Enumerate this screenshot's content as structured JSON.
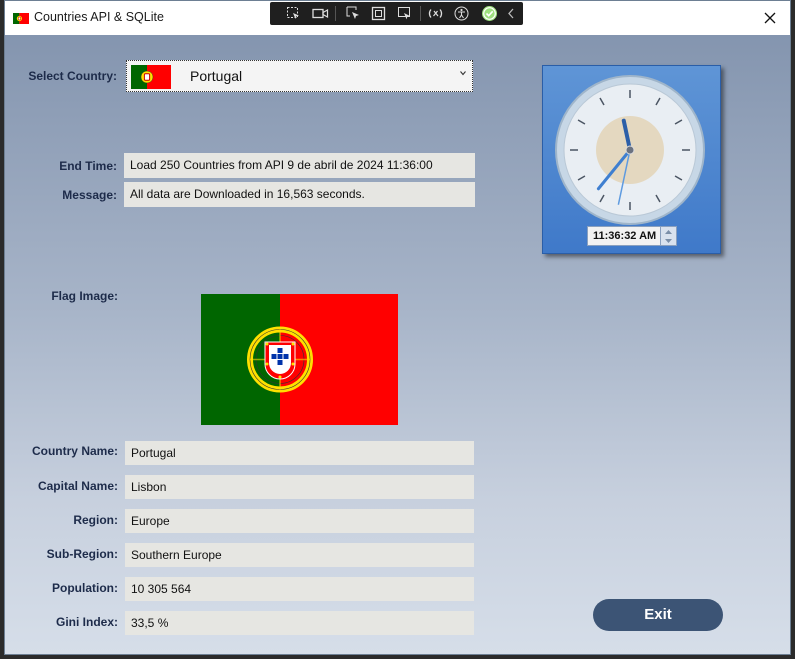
{
  "window": {
    "title": "Countries API & SQLite"
  },
  "toolbar": {
    "icons": [
      "select-element-icon",
      "video-icon",
      "pointer-icon",
      "frame-icon",
      "selection-icon",
      "hot-reload-icon",
      "accessibility-icon",
      "checkmark-icon",
      "chevron-left-icon"
    ]
  },
  "select": {
    "label": "Select Country:",
    "value": "Portugal"
  },
  "end_time": {
    "label": "End Time:",
    "value": "Load 250 Countries from API 9 de abril de 2024 11:36:00"
  },
  "message": {
    "label": "Message:",
    "value": "All data are Downloaded in 16,563 seconds."
  },
  "flag": {
    "label": "Flag Image:"
  },
  "fields": [
    {
      "label": "Country Name:",
      "value": "Portugal"
    },
    {
      "label": "Capital Name:",
      "value": "Lisbon"
    },
    {
      "label": "Region:",
      "value": "Europe"
    },
    {
      "label": "Sub-Region:",
      "value": "Southern Europe"
    },
    {
      "label": "Population:",
      "value": "10 305 564"
    },
    {
      "label": "Gini Index:",
      "value": "33,5 %"
    }
  ],
  "clock": {
    "time": "11:36:32 AM"
  },
  "exit": {
    "label": "Exit"
  },
  "colors": {
    "flag_green": "#006600",
    "flag_red": "#ff0000",
    "accent": "#3c5475"
  }
}
